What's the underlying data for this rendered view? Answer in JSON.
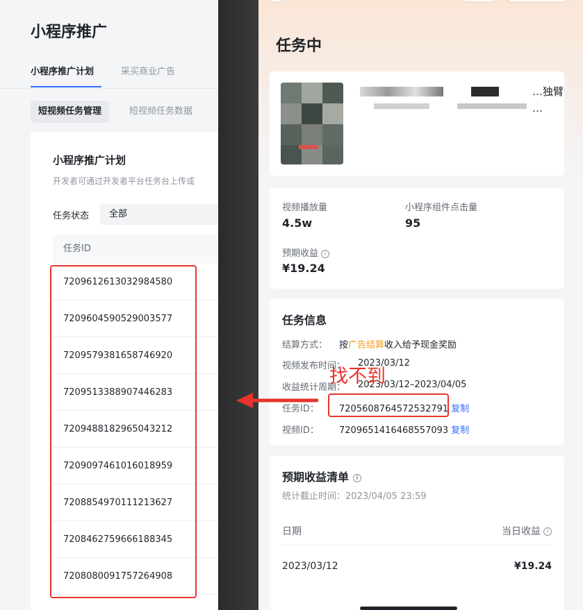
{
  "left": {
    "page_title": "小程序推广",
    "tabs": [
      {
        "label": "小程序推广计划",
        "active": true
      },
      {
        "label": "采买商业广告",
        "active": false
      }
    ],
    "subtabs": [
      {
        "label": "短视频任务管理",
        "active": true
      },
      {
        "label": "短视频任务数据",
        "active": false
      }
    ],
    "plan_title": "小程序推广计划",
    "plan_desc": "开发者可通过开发者平台任务台上传或",
    "status_label": "任务状态",
    "status_value": "全部",
    "table_header": "任务ID",
    "task_ids": [
      "7209612613032984580",
      "7209604590529003577",
      "7209579381658746920",
      "7209513388907446283",
      "7209488182965043212",
      "7209097461016018959",
      "7208854970111213627",
      "7208462759666188345",
      "7208080091757264908"
    ]
  },
  "right": {
    "title": "任务中",
    "video_title_line1": "…独臂",
    "video_title_line2": "…",
    "stats": {
      "plays_label": "视频播放量",
      "plays_value": "4.5w",
      "clicks_label": "小程序组件点击量",
      "clicks_value": "95",
      "expected_label": "预期收益",
      "expected_value": "¥19.24"
    },
    "task_info": {
      "title": "任务信息",
      "settle_label": "结算方式：",
      "settle_prefix": "按",
      "settle_highlight": "广告结算",
      "settle_suffix": "收入给予现金奖励",
      "publish_label": "视频发布时间：",
      "publish_value": "2023/03/12",
      "period_label": "收益统计周期：",
      "period_value": "2023/03/12–2023/04/05",
      "task_id_label": "任务ID：",
      "task_id_value": "7205608764572532791",
      "video_id_label": "视频ID：",
      "video_id_value": "7209651416468557093",
      "copy_label": "复制"
    },
    "earnings": {
      "title": "预期收益清单",
      "cutoff_label": "统计截止时间：",
      "cutoff_value": "2023/04/05 23:59",
      "col_date": "日期",
      "col_income": "当日收益",
      "rows": [
        {
          "date": "2023/03/12",
          "income": "¥19.24"
        }
      ]
    }
  },
  "annotation": {
    "text": "找不到",
    "color": "#e8342c"
  },
  "colors": {
    "accent": "#3370ff",
    "highlight": "#f0a020",
    "annotation_red": "#e8342c"
  }
}
